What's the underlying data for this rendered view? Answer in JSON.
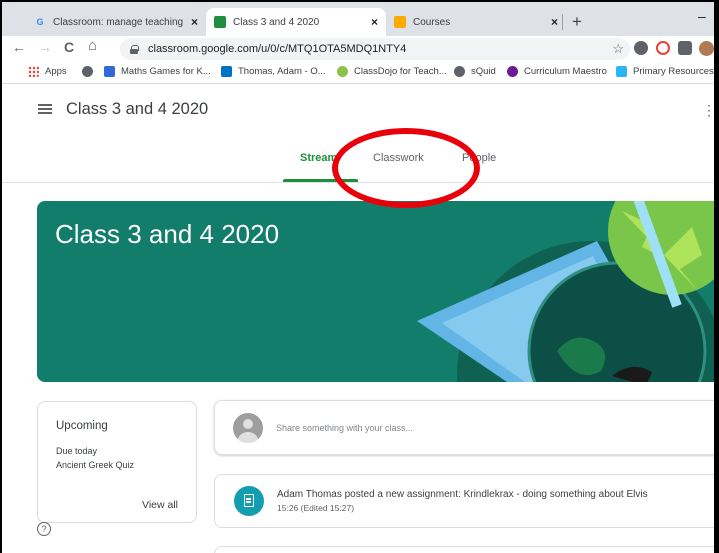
{
  "browser": {
    "tabs": [
      {
        "title": "Classroom: manage teaching and",
        "active": false
      },
      {
        "title": "Class 3 and 4 2020",
        "active": true
      },
      {
        "title": "Courses",
        "active": false
      }
    ],
    "close_glyph": "×",
    "new_tab_glyph": "+",
    "minimize_glyph": "–",
    "url": "classroom.google.com/u/0/c/MTQ1OTA5MDQ1NTY4",
    "nav": {
      "back": "←",
      "forward": "→",
      "reload": "C",
      "home": "⌂",
      "star": "☆"
    },
    "bookmarks": [
      {
        "label": "Apps",
        "icon": "apps-grid-icon"
      },
      {
        "label": "",
        "icon": "squid-icon"
      },
      {
        "label": "Maths Games for K...",
        "icon": "maths-games-icon"
      },
      {
        "label": "Thomas, Adam - O...",
        "icon": "outlook-icon"
      },
      {
        "label": "ClassDojo for Teach...",
        "icon": "classdojo-icon"
      },
      {
        "label": "sQuid",
        "icon": "squid-icon"
      },
      {
        "label": "Curriculum Maestro",
        "icon": "curriculum-maestro-icon"
      },
      {
        "label": "Primary Resources -",
        "icon": "primary-resources-icon"
      }
    ]
  },
  "classroom": {
    "class_name": "Class 3 and 4 2020",
    "tabs": [
      "Stream",
      "Classwork",
      "People"
    ],
    "active_tab": "Stream",
    "banner_title": "Class 3 and 4 2020",
    "upcoming": {
      "title": "Upcoming",
      "due": "Due today",
      "item": "Ancient Greek Quiz",
      "view_all": "View all"
    },
    "share_placeholder": "Share something with your class...",
    "post": {
      "title": "Adam Thomas posted a new assignment: Krindlekrax - doing something about Elvis",
      "time": "15:26 (Edited 15:27)"
    },
    "help_glyph": "?"
  },
  "colors": {
    "banner": "#127d6a",
    "active_tab": "#1e8e3e",
    "assignment_icon": "#129eaf",
    "annotation": "#e8000b"
  }
}
